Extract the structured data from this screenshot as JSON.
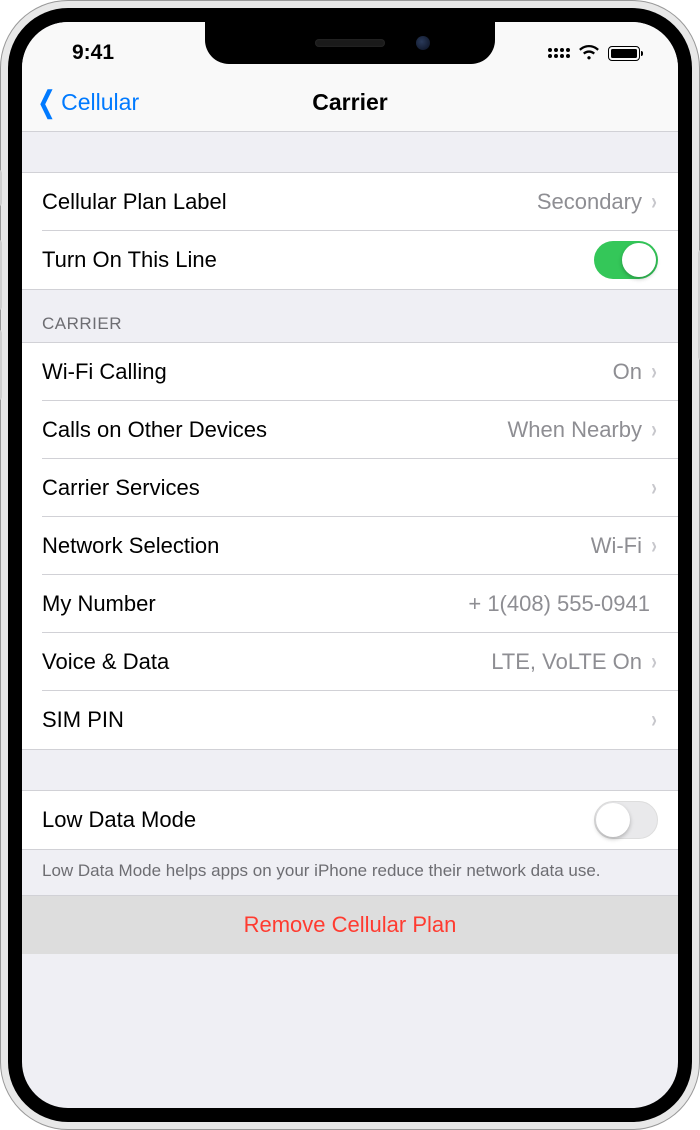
{
  "status": {
    "time": "9:41"
  },
  "nav": {
    "back_label": "Cellular",
    "title": "Carrier"
  },
  "section1": {
    "plan_label": {
      "label": "Cellular Plan Label",
      "value": "Secondary"
    },
    "turn_on": {
      "label": "Turn On This Line",
      "on": true
    }
  },
  "section2": {
    "header": "Carrier",
    "wifi_calling": {
      "label": "Wi-Fi Calling",
      "value": "On"
    },
    "other_devices": {
      "label": "Calls on Other Devices",
      "value": "When Nearby"
    },
    "carrier_services": {
      "label": "Carrier Services",
      "value": ""
    },
    "network_selection": {
      "label": "Network Selection",
      "value": "Wi-Fi"
    },
    "my_number": {
      "label": "My Number",
      "value": "+ 1(408) 555-0941"
    },
    "voice_data": {
      "label": "Voice & Data",
      "value": "LTE, VoLTE On"
    },
    "sim_pin": {
      "label": "SIM PIN",
      "value": ""
    }
  },
  "section3": {
    "low_data": {
      "label": "Low Data Mode",
      "on": false
    },
    "footer": "Low Data Mode helps apps on your iPhone reduce their network data use."
  },
  "section4": {
    "remove": "Remove Cellular Plan"
  }
}
